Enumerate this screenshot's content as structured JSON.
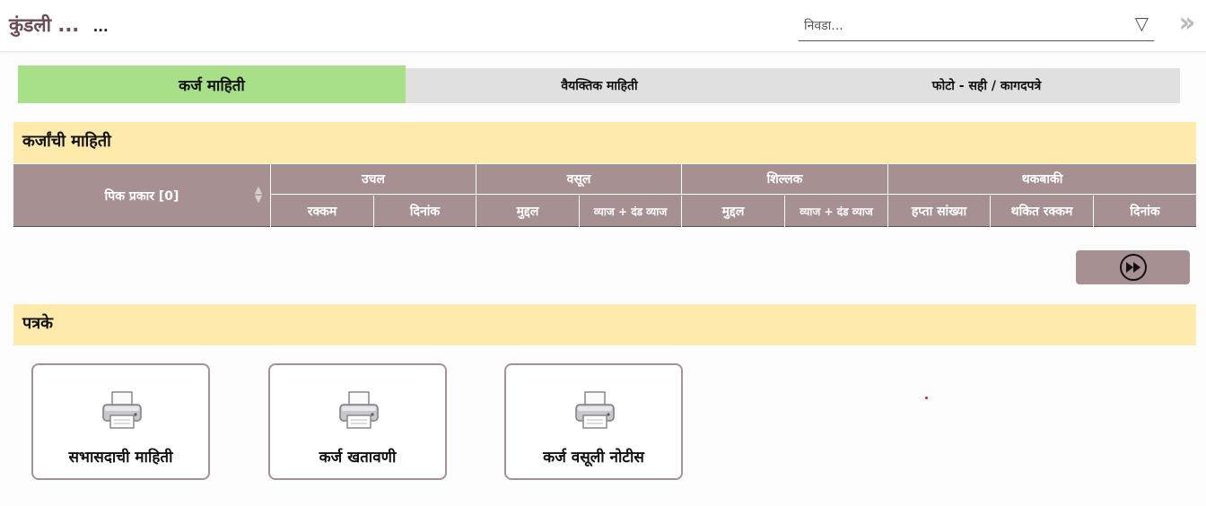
{
  "header": {
    "title": "कुंडली ...",
    "subtitle": "...",
    "select": {
      "placeholder": "निवडा..."
    },
    "collapse_icon": "double-chevron-right-icon"
  },
  "tabs": [
    {
      "label": "कर्ज माहिती",
      "active": true
    },
    {
      "label": "वैयक्तिक माहिती",
      "active": false
    },
    {
      "label": "फोटो - सही / कागदपत्रे",
      "active": false
    }
  ],
  "loan_section": {
    "title": "कर्जांची माहिती",
    "table": {
      "crop_type_header": "पिक प्रकार [0]",
      "groups": [
        "उचल",
        "वसूल",
        "शिल्लक",
        "थकबाकी"
      ],
      "columns": [
        "रक्कम",
        "दिनांक",
        "मुद्दल",
        "व्याज + दंड व्याज",
        "मुद्दल",
        "व्याज + दंड व्याज",
        "हप्ता सांख्या",
        "थकित रक्कम",
        "दिनांक"
      ]
    },
    "next_button_icon": "fast-forward-icon"
  },
  "reports_section": {
    "title": "पत्रके",
    "cards": [
      {
        "label": "सभासदाची माहिती",
        "icon": "printer-icon"
      },
      {
        "label": "कर्ज खतावणी",
        "icon": "printer-icon"
      },
      {
        "label": "कर्ज वसूली नोटीस",
        "icon": "printer-icon"
      }
    ]
  },
  "colors": {
    "accent_tab": "#a8e08a",
    "section_header": "#feebab",
    "table_header": "#a79091",
    "title_text": "#6b4d52"
  }
}
